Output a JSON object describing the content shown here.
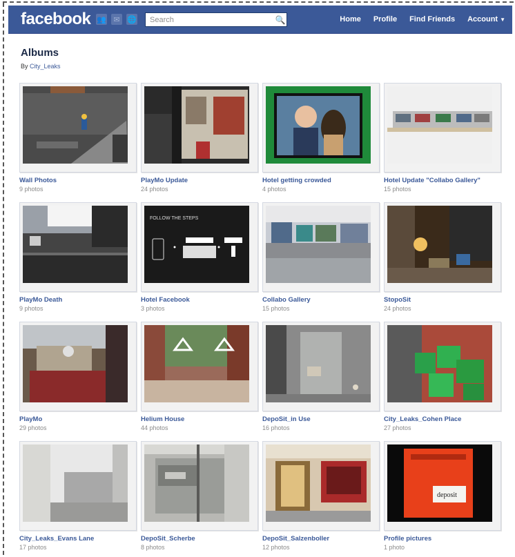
{
  "header": {
    "logo": "facebook",
    "search_placeholder": "Search",
    "nav": [
      "Home",
      "Profile",
      "Find Friends",
      "Account"
    ]
  },
  "page": {
    "title": "Albums",
    "by_prefix": "By ",
    "by_user": "City_Leaks"
  },
  "albums": [
    {
      "title": "Wall Photos",
      "count": "9 photos",
      "thumb": "lego-stairs"
    },
    {
      "title": "PlayMo Update",
      "count": "24 photos",
      "thumb": "dark-scaffold"
    },
    {
      "title": "Hotel getting crowded",
      "count": "4 photos",
      "thumb": "green-frame"
    },
    {
      "title": "Hotel Update \"Collabo Gallery\"",
      "count": "15 photos",
      "thumb": "white-facade"
    },
    {
      "title": "PlayMo Death",
      "count": "9 photos",
      "thumb": "dark-wall"
    },
    {
      "title": "Hotel Facebook",
      "count": "3 photos",
      "thumb": "phone-steps"
    },
    {
      "title": "Collabo Gallery",
      "count": "15 photos",
      "thumb": "colorful-model"
    },
    {
      "title": "StopoSit",
      "count": "24 photos",
      "thumb": "street-night"
    },
    {
      "title": "PlayMo",
      "count": "29 photos",
      "thumb": "red-courtyard"
    },
    {
      "title": "Helium House",
      "count": "44 photos",
      "thumb": "tree-plaza"
    },
    {
      "title": "DepoSit_in Use",
      "count": "16 photos",
      "thumb": "grey-shelf"
    },
    {
      "title": "City_Leaks_Cohen Place",
      "count": "27 photos",
      "thumb": "green-crates"
    },
    {
      "title": "City_Leaks_Evans Lane",
      "count": "17 photos",
      "thumb": "grey-block"
    },
    {
      "title": "DepoSit_Scherbe",
      "count": "8 photos",
      "thumb": "mailbox"
    },
    {
      "title": "DepoSit_Salzenboller",
      "count": "12 photos",
      "thumb": "shop-front"
    },
    {
      "title": "Profile pictures",
      "count": "1 photo",
      "thumb": "red-box"
    }
  ]
}
